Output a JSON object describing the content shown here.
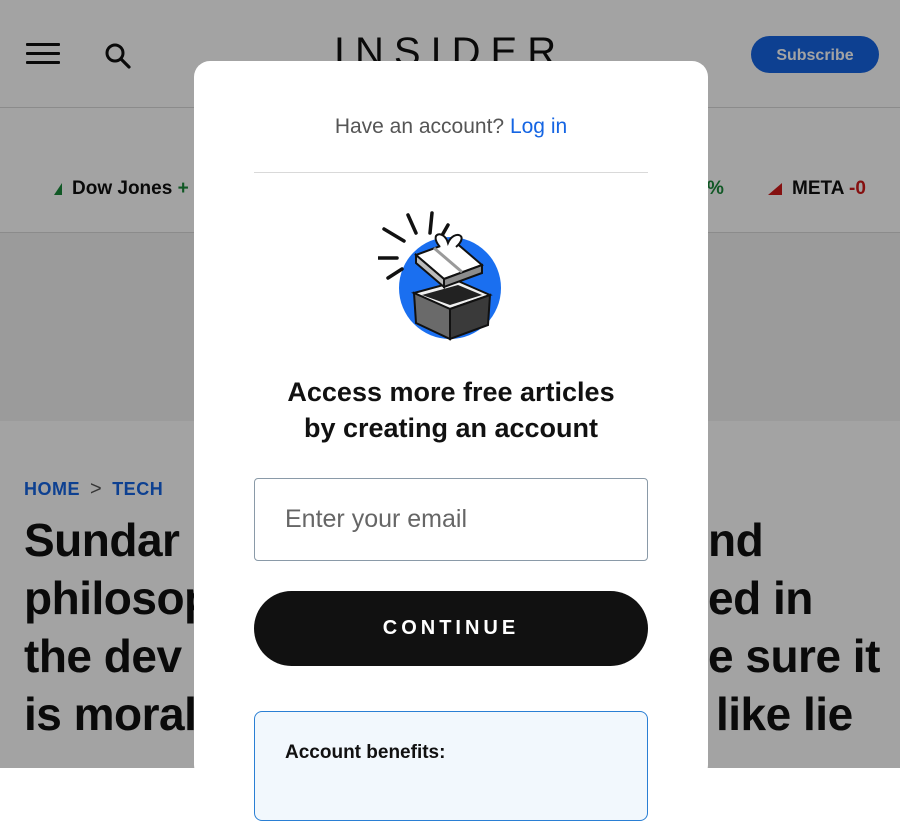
{
  "header": {
    "logo": "INSIDER",
    "subscribe_label": "Subscribe",
    "accent_color": "#1565e3"
  },
  "ticker": [
    {
      "name": "Dow Jones",
      "change": "+",
      "direction": "up"
    },
    {
      "name": "META",
      "change": "-0",
      "direction": "down"
    },
    {
      "change": "%"
    }
  ],
  "breadcrumb": {
    "home": "HOME",
    "separator": ">",
    "section": "TECH"
  },
  "headline": {
    "lines": [
      "Sundar",
      "philosop",
      "the dev",
      "is moral"
    ],
    "right_fragments": [
      "nd",
      "ed in",
      "e sure it",
      "like lie"
    ]
  },
  "modal": {
    "have_account": "Have an account?",
    "login_link": "Log in",
    "gift_icon": "gift-box-icon",
    "title_line1": "Access more free articles",
    "title_line2": "by creating an account",
    "email_placeholder": "Enter your email",
    "email_value": "",
    "continue_label": "CONTINUE",
    "benefits_title": "Account benefits:"
  }
}
